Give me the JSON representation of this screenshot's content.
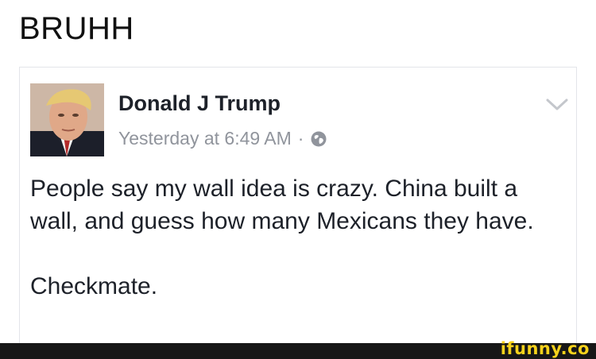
{
  "caption": "BRUHH",
  "post": {
    "author": "Donald J Trump",
    "timestamp": "Yesterday at 6:49 AM",
    "separator": "·",
    "privacy_icon": "globe-icon",
    "menu_icon": "chevron-down-icon",
    "paragraphs": [
      "People say my wall idea is crazy. China built a wall, and guess how many Mexicans they have.",
      "Checkmate."
    ]
  },
  "watermark": "ifunny.co",
  "colors": {
    "author": "#1d2129",
    "meta": "#90949c",
    "border": "#e3e5ea",
    "watermark": "#f7d21b",
    "footer": "#171717"
  }
}
